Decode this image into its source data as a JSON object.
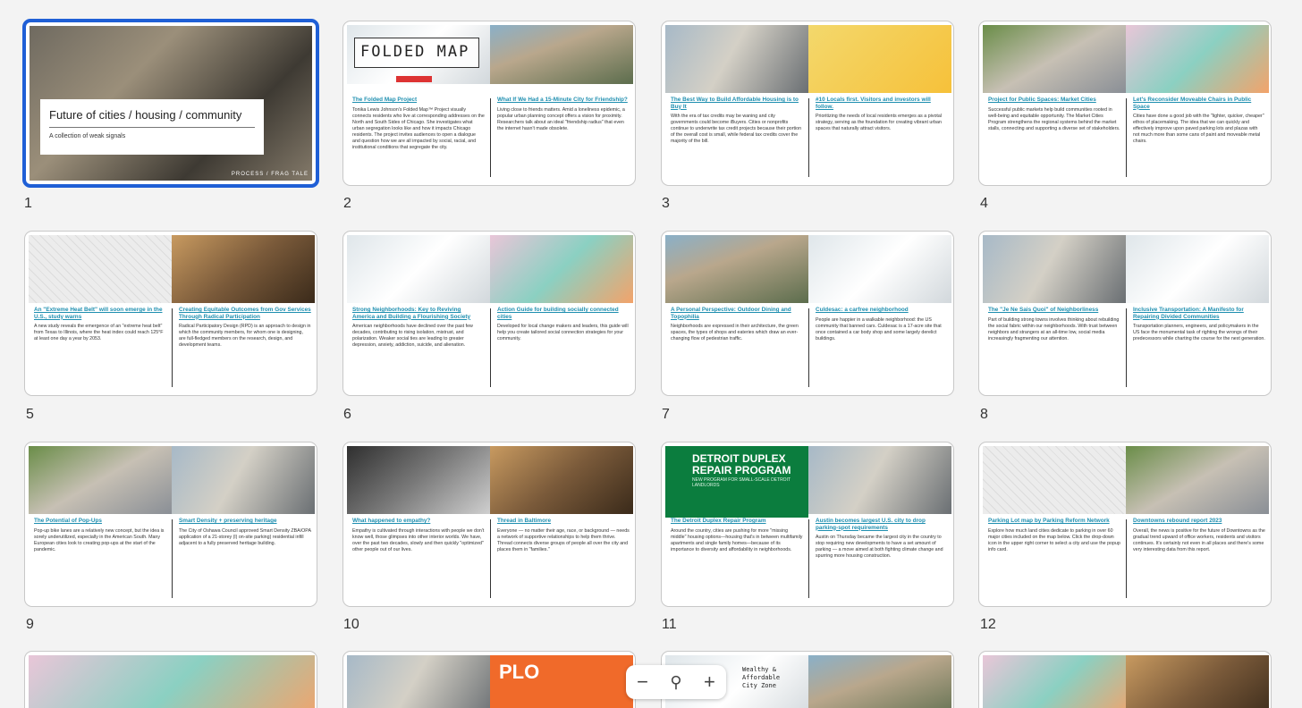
{
  "slides": [
    {
      "num": "1",
      "title": "Future of cities / housing / community",
      "subtitle": "A collection of weak signals",
      "credit": "PROCESS / FRAG TALE"
    },
    {
      "num": "2",
      "banner": "FOLDED MAP",
      "left": {
        "title": "The Folded Map Project",
        "body": "Tonika Lewis Johnson's Folded Map™ Project visually connects residents who live at corresponding addresses on the North and South Sides of Chicago. She investigates what urban segregation looks like and how it impacts Chicago residents. The project invites audiences to open a dialogue and question how we are all impacted by social, racial, and institutional conditions that segregate the city."
      },
      "right": {
        "title": "What If We Had a 15-Minute City for Friendship?",
        "body": "Living close to friends matters. Amid a loneliness epidemic, a popular urban planning concept offers a vision for proximity. Researchers talk about an ideal \"friendship radius\" that even the internet hasn't made obsolete."
      }
    },
    {
      "num": "3",
      "left": {
        "title": "The Best Way to Build Affordable Housing is to Buy It",
        "body": "With the era of tax credits may be waning and city governments could become iBuyers. Cities or nonprofits continue to underwrite tax credit projects because their portion of the overall cost is small, while federal tax credits cover the majority of the bill."
      },
      "right": {
        "title": "#10 Locals first. Visitors and investors will follow.",
        "body": "Prioritizing the needs of local residents emerges as a pivotal strategy, serving as the foundation for creating vibrant urban spaces that naturally attract visitors."
      }
    },
    {
      "num": "4",
      "left": {
        "title": "Project for Public Spaces: Market Cities",
        "body": "Successful public markets help build communities rooted in well-being and equitable opportunity. The Market Cities Program strengthens the regional systems behind the market stalls, connecting and supporting a diverse set of stakeholders."
      },
      "right": {
        "title": "Let's Reconsider Moveable Chairs in Public Space",
        "body": "Cities have done a good job with the \"lighter, quicker, cheaper\" ethos of placemaking. The idea that we can quickly and effectively improve upon paved parking lots and plazas with not much more than some cans of paint and moveable metal chairs."
      }
    },
    {
      "num": "5",
      "left": {
        "title": "An \"Extreme Heat Belt\" will soon emerge in the U.S., study warns",
        "body": "A new study reveals the emergence of an \"extreme heat belt\" from Texas to Illinois, where the heat index could reach 125°F at least one day a year by 2053."
      },
      "right": {
        "title": "Creating Equitable Outcomes from Gov Services Through Radical Participation",
        "body": "Radical Participatory Design (RPD) is an approach to design in which the community members, for whom one is designing, are full-fledged members on the research, design, and development teams."
      }
    },
    {
      "num": "6",
      "left": {
        "title": "Strong Neighborhoods: Key to Reviving America and Building a Flourishing Society",
        "body": "American neighborhoods have declined over the past few decades, contributing to rising isolation, mistrust, and polarization. Weaker social ties are leading to greater depression, anxiety, addiction, suicide, and alienation."
      },
      "right": {
        "title": "Action Guide for building socially connected cities",
        "body": "Developed for local change makers and leaders, this guide will help you create tailored social connection strategies for your community."
      }
    },
    {
      "num": "7",
      "left": {
        "title": "A Personal Perspective: Outdoor Dining and Topophilia",
        "body": "Neighborhoods are expressed in their architecture, the green spaces, the types of shops and eateries which draw an ever-changing flow of pedestrian traffic."
      },
      "right": {
        "title": "Culdesac: a carfree neighborhood",
        "body": "People are happier in a walkable neighborhood: the US community that banned cars. Culdesac is a 17-acre site that once contained a car body shop and some largely derelict buildings."
      }
    },
    {
      "num": "8",
      "left": {
        "title": "The \"Je Ne Sais Quoi\" of Neighborliness",
        "body": "Part of building strong towns involves thinking about rebuilding the social fabric within our neighborhoods. With trust between neighbors and strangers at an all-time low, social media increasingly fragmenting our attention."
      },
      "right": {
        "title": "Inclusive Transportation: A Manifesto for Repairing Divided Communities",
        "body": "Transportation planners, engineers, and policymakers in the US face the monumental task of righting the wrongs of their predecessors while charting the course for the next generation."
      }
    },
    {
      "num": "9",
      "left": {
        "title": "The Potential of Pop-Ups",
        "body": "Pop-up bike lanes are a relatively new concept, but the idea is sorely underutilized, especially in the American South. Many European cities look to creating pop-ups at the start of the pandemic."
      },
      "right": {
        "title": "Smart Density + preserving heritage",
        "body": "The City of Oshawa Council approved Smart Density ZBA/OPA application of a 21-storey (l) on-site parking) residential infill adjacent to a fully preserved heritage building."
      }
    },
    {
      "num": "10",
      "left": {
        "title": "What happened to empathy?",
        "body": "Empathy is cultivated through interactions with people we don't know well, those glimpses into other interior worlds. We have, over the past two decades, slowly and then quickly \"optimized\" other people out of our lives."
      },
      "right": {
        "title": "Thread in Baltimore",
        "body": "Everyone — no matter their age, race, or background — needs a network of supportive relationships to help them thrive. Thread connects diverse groups of people all over the city and places them in \"families.\""
      }
    },
    {
      "num": "11",
      "banner": "DETROIT DUPLEX REPAIR PROGRAM",
      "banner_sub": "NEW PROGRAM FOR SMALL-SCALE DETROIT LANDLORDS",
      "left": {
        "title": "The Detroit Duplex Repair Program",
        "body": "Around the country, cities are pushing for more \"missing middle\" housing options—housing that's in between multifamily apartments and single family homes—because of its importance to diversity and affordability in neighborhoods."
      },
      "right": {
        "title": "Austin becomes largest U.S. city to drop parking-spot requirements",
        "body": "Austin on Thursday became the largest city in the country to stop requiring new developments to have a set amount of parking — a move aimed at both fighting climate change and spurring more housing construction."
      }
    },
    {
      "num": "12",
      "left": {
        "title": "Parking Lot map by Parking Reform Network",
        "body": "Explore how much land cities dedicate to parking in over 60 major cities included on the map below. Click the drop-down icon in the upper right corner to select a city and use the popup info card."
      },
      "right": {
        "title": "Downtowns rebound report 2023",
        "body": "Overall, the news is positive for the future of Downtowns as the gradual trend upward of office workers, residents and visitors continues. It's certainly not even in all places and there's some very interesting data from this report."
      }
    }
  ],
  "partial_row": {
    "label_fragment": "PLO",
    "zone_label": "Wealthy & Affordable City Zone"
  },
  "zoom": {
    "out_icon": "−",
    "fit_icon": "⚲",
    "in_icon": "+"
  }
}
